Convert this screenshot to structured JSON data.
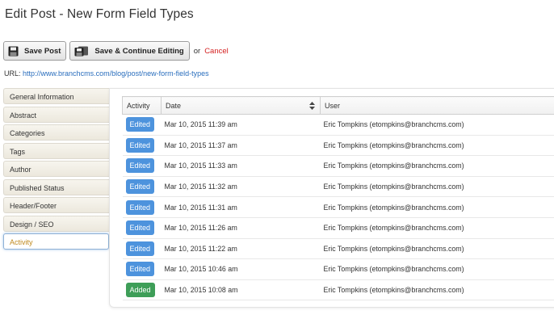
{
  "page": {
    "title": "Edit Post - New Form Field Types"
  },
  "toolbar": {
    "save_label": "Save Post",
    "save_continue_label": "Save & Continue Editing",
    "or_text": "or",
    "cancel_label": "Cancel",
    "cancel_color": "#d42020"
  },
  "url": {
    "label": "URL:",
    "value": "http://www.branchcms.com/blog/post/new-form-field-types"
  },
  "sidebar": {
    "items": [
      {
        "label": "General Information",
        "active": false
      },
      {
        "label": "Abstract",
        "active": false
      },
      {
        "label": "Categories",
        "active": false
      },
      {
        "label": "Tags",
        "active": false
      },
      {
        "label": "Author",
        "active": false
      },
      {
        "label": "Published Status",
        "active": false
      },
      {
        "label": "Header/Footer",
        "active": false
      },
      {
        "label": "Design / SEO",
        "active": false
      },
      {
        "label": "Activity",
        "active": true
      }
    ]
  },
  "table": {
    "headers": {
      "activity": "Activity",
      "date": "Date",
      "user": "User"
    },
    "sort_icon": "sort-updown-icon",
    "rows": [
      {
        "activity": "Edited",
        "date": "Mar 10, 2015 11:39 am",
        "user": "Eric Tompkins (etompkins@branchcms.com)"
      },
      {
        "activity": "Edited",
        "date": "Mar 10, 2015 11:37 am",
        "user": "Eric Tompkins (etompkins@branchcms.com)"
      },
      {
        "activity": "Edited",
        "date": "Mar 10, 2015 11:33 am",
        "user": "Eric Tompkins (etompkins@branchcms.com)"
      },
      {
        "activity": "Edited",
        "date": "Mar 10, 2015 11:32 am",
        "user": "Eric Tompkins (etompkins@branchcms.com)"
      },
      {
        "activity": "Edited",
        "date": "Mar 10, 2015 11:31 am",
        "user": "Eric Tompkins (etompkins@branchcms.com)"
      },
      {
        "activity": "Edited",
        "date": "Mar 10, 2015 11:26 am",
        "user": "Eric Tompkins (etompkins@branchcms.com)"
      },
      {
        "activity": "Edited",
        "date": "Mar 10, 2015 11:22 am",
        "user": "Eric Tompkins (etompkins@branchcms.com)"
      },
      {
        "activity": "Edited",
        "date": "Mar 10, 2015 10:46 am",
        "user": "Eric Tompkins (etompkins@branchcms.com)"
      },
      {
        "activity": "Added",
        "date": "Mar 10, 2015 10:08 am",
        "user": "Eric Tompkins (etompkins@branchcms.com)"
      }
    ]
  },
  "colors": {
    "edited_badge": "#4d93dd",
    "added_badge": "#3e9e58",
    "link": "#2a6ebd",
    "active_tab_text": "#c08a1e"
  }
}
